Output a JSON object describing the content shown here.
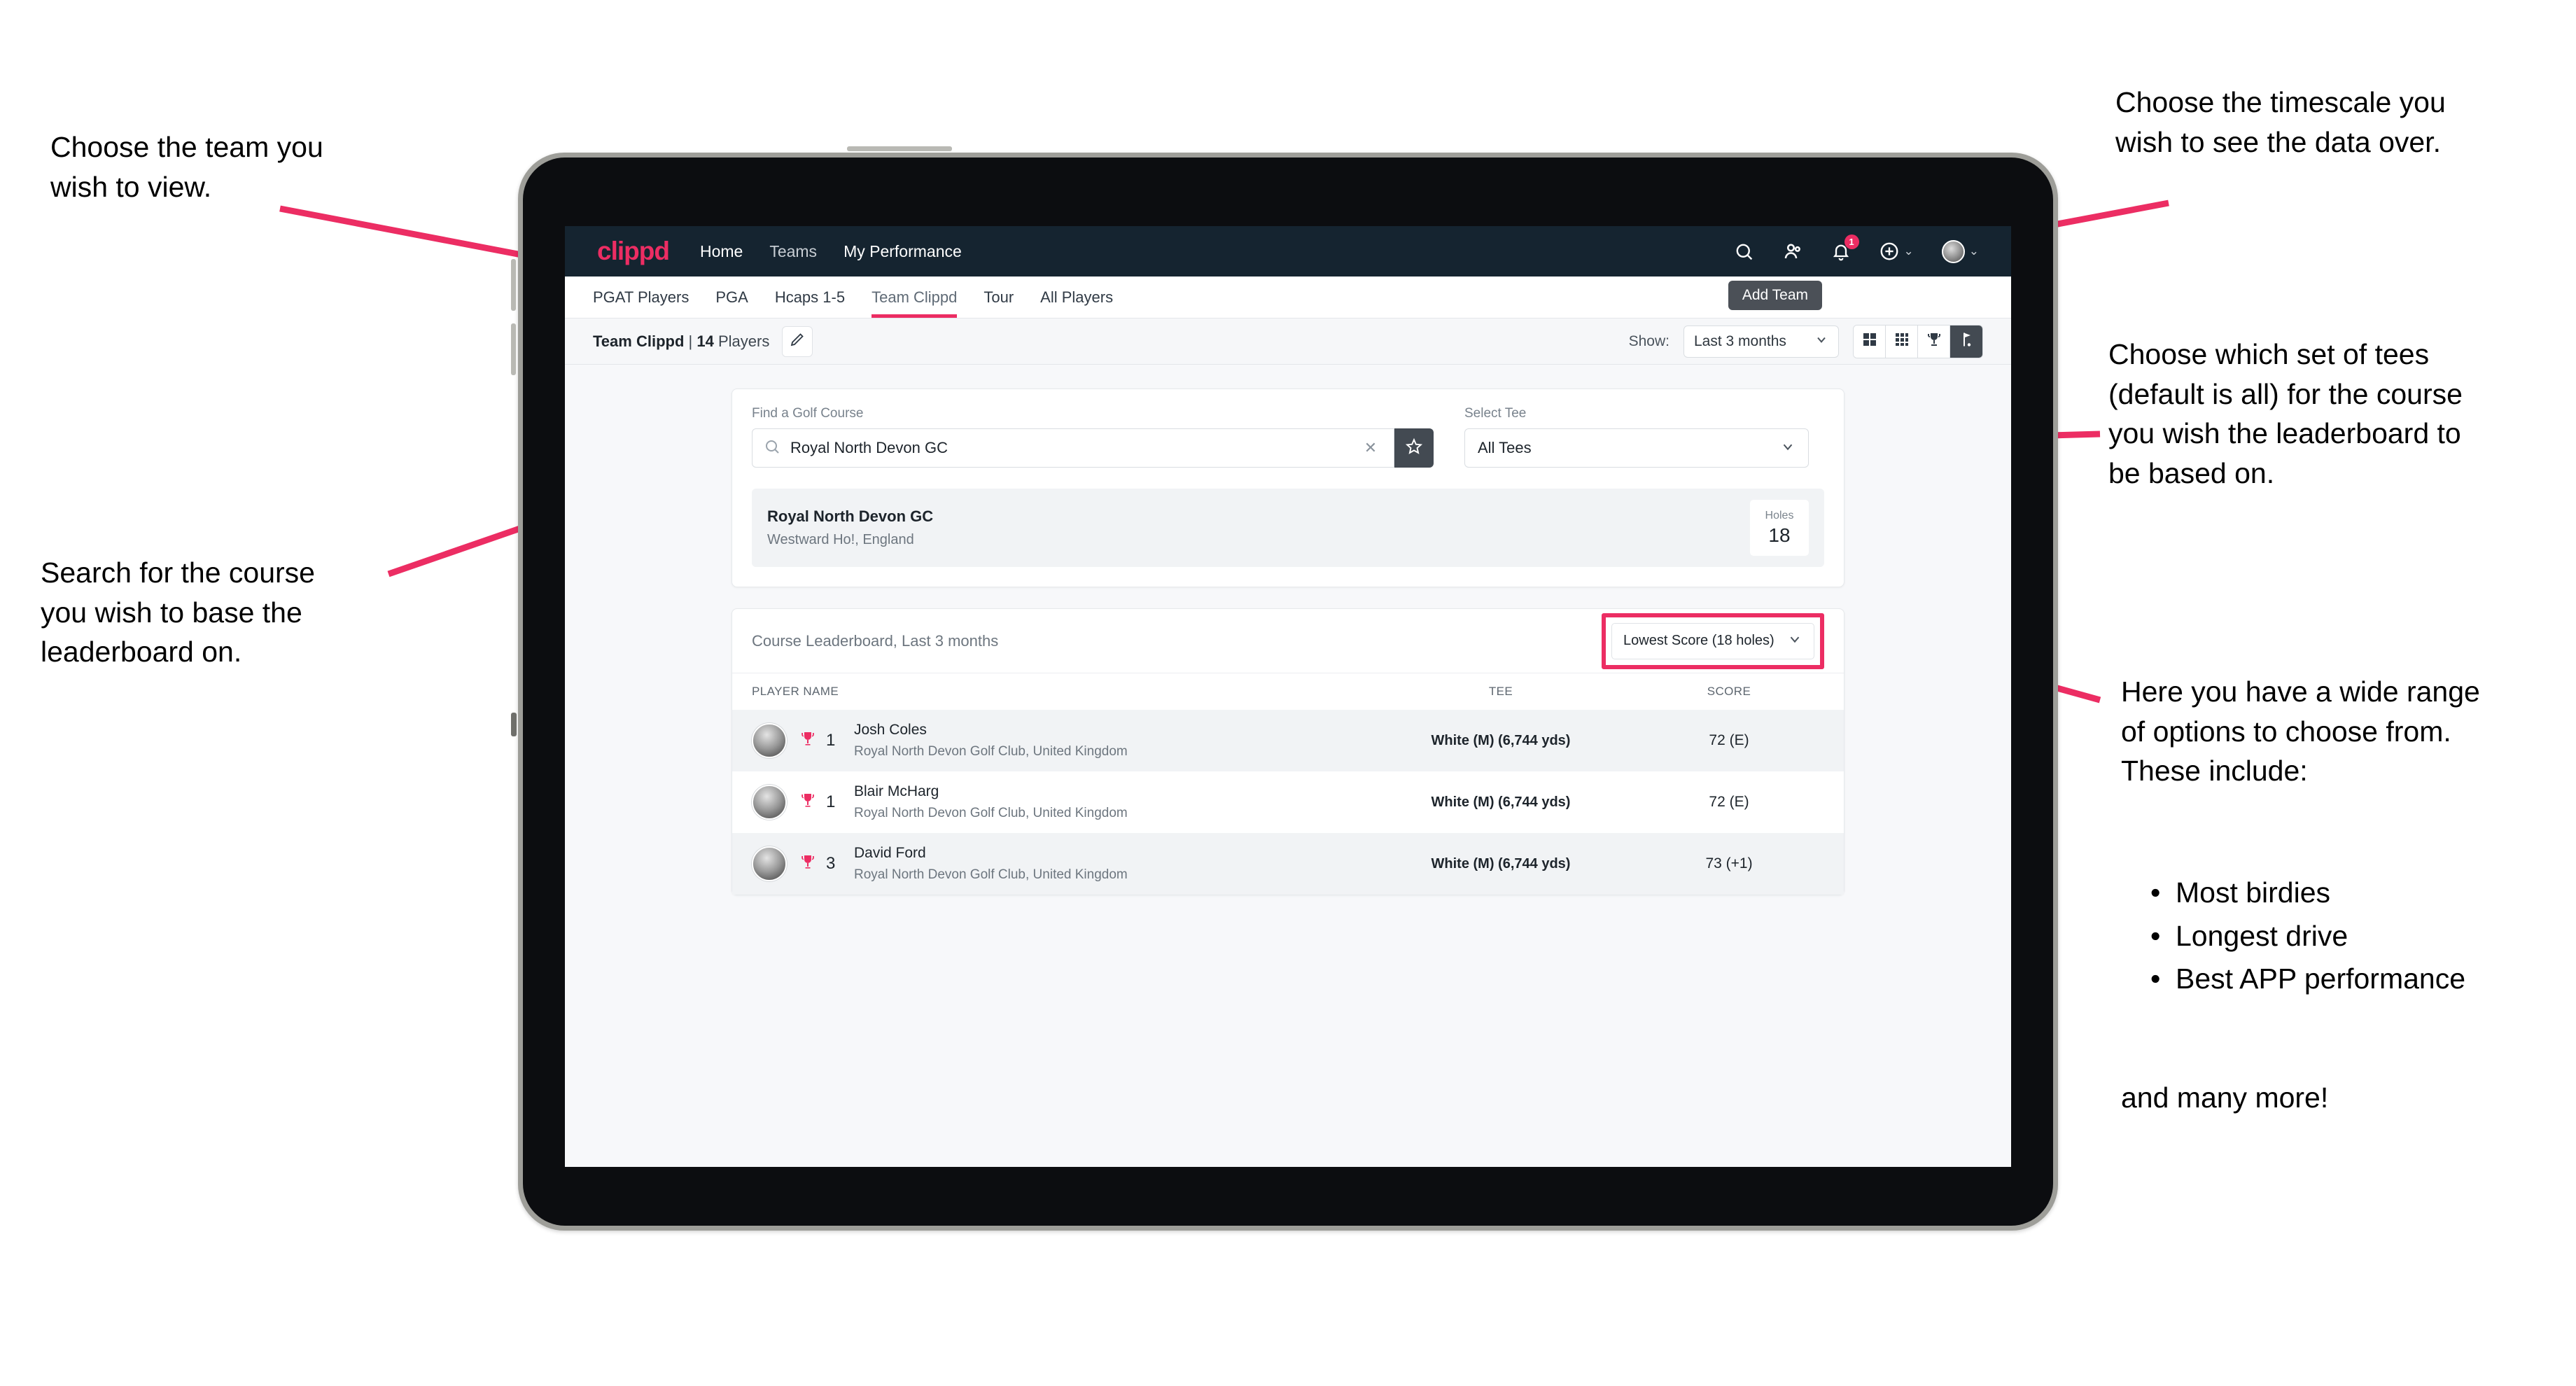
{
  "annotations": {
    "left_top": "Choose the team you\nwish to view.",
    "left_bottom": "Search for the course\nyou wish to base the\nleaderboard on.",
    "right_top": "Choose the timescale you\nwish to see the data over.",
    "right_mid": "Choose which set of tees\n(default is all) for the course\nyou wish the leaderboard to\nbe based on.",
    "right_bottom_intro": "Here you have a wide range\nof options to choose from.\nThese include:",
    "right_bullets": [
      "Most birdies",
      "Longest drive",
      "Best APP performance"
    ],
    "right_bottom_tail": "and many more!"
  },
  "app": {
    "logo": "clippd",
    "topnav": [
      {
        "label": "Home",
        "active": true
      },
      {
        "label": "Teams",
        "active": false
      },
      {
        "label": "My Performance",
        "active": true
      }
    ],
    "top_icons": {
      "search": "search-icon",
      "people": "people-icon",
      "notifications": "bell-icon",
      "notification_count": "1",
      "add": "plus-circle-icon",
      "profile": "avatar-icon",
      "caret": "⌄"
    },
    "tabs": [
      {
        "label": "PGAT Players",
        "active": false
      },
      {
        "label": "PGA",
        "active": false
      },
      {
        "label": "Hcaps 1-5",
        "active": false
      },
      {
        "label": "Team Clippd",
        "active": true
      },
      {
        "label": "Tour",
        "active": false
      },
      {
        "label": "All Players",
        "active": false
      }
    ],
    "tooltip": "Add Team",
    "subbar": {
      "team_name": "Team Clippd",
      "separator": "|",
      "player_count": "14",
      "players_word": "Players",
      "edit_icon": "pencil-icon",
      "show_label": "Show:",
      "show_value": "Last 3 months",
      "view_toggles": [
        {
          "icon": "grid-2x2-icon",
          "active": false
        },
        {
          "icon": "grid-3x3-icon",
          "active": false
        },
        {
          "icon": "trophy-icon",
          "active": false
        },
        {
          "icon": "golf-flag-icon",
          "active": true
        }
      ]
    },
    "search_panel": {
      "course_label": "Find a Golf Course",
      "course_value": "Royal North Devon GC",
      "course_placeholder": "Find a Golf Course",
      "clear_icon": "close-icon",
      "favorite_icon": "star-icon",
      "tee_label": "Select Tee",
      "tee_value": "All Tees"
    },
    "course_result": {
      "name": "Royal North Devon GC",
      "location": "Westward Ho!, England",
      "holes_label": "Holes",
      "holes_value": "18"
    },
    "leaderboard": {
      "title": "Course Leaderboard,",
      "subtitle": "Last 3 months",
      "sort_value": "Lowest Score (18 holes)",
      "columns": [
        "PLAYER NAME",
        "TEE",
        "SCORE"
      ],
      "rows": [
        {
          "rank": "1",
          "name": "Josh Coles",
          "club": "Royal North Devon Golf Club, United Kingdom",
          "tee": "White (M) (6,744 yds)",
          "score": "72 (E)"
        },
        {
          "rank": "1",
          "name": "Blair McHarg",
          "club": "Royal North Devon Golf Club, United Kingdom",
          "tee": "White (M) (6,744 yds)",
          "score": "72 (E)"
        },
        {
          "rank": "3",
          "name": "David Ford",
          "club": "Royal North Devon Golf Club, United Kingdom",
          "tee": "White (M) (6,744 yds)",
          "score": "73 (+1)"
        }
      ]
    }
  },
  "colors": {
    "accent": "#ec2d63",
    "topbar": "#152430",
    "dark_control": "#434a52",
    "page_bg": "#f7f8fa"
  }
}
